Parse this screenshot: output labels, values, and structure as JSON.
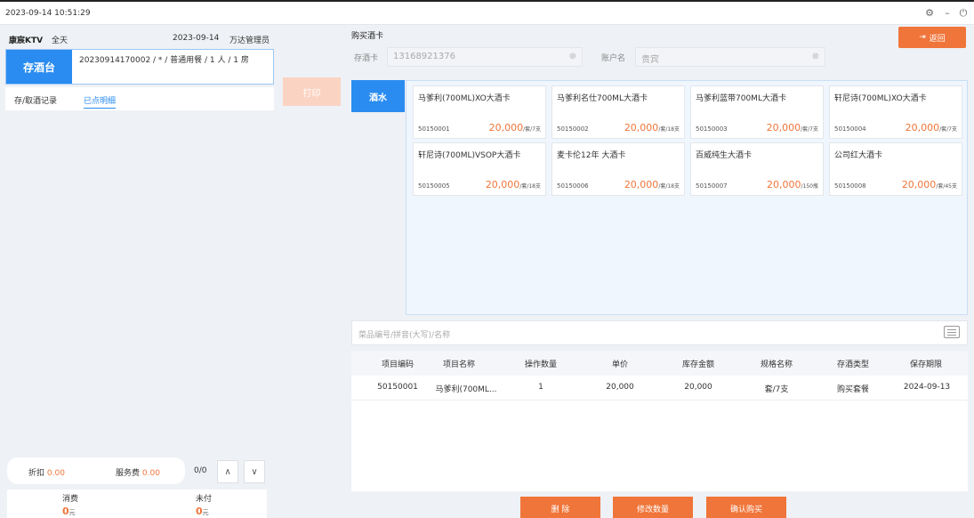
{
  "titlebar": {
    "time": "2023-09-14 10:51:29"
  },
  "left": {
    "store_name": "康宸KTV",
    "scope": "全天",
    "date": "2023-09-14",
    "manager": "万达管理员",
    "depot_label": "存酒台",
    "order_info": "20230914170002 / * / 普通用餐 / 1 人 / 1 房",
    "tabs": [
      "存/取酒记录",
      "已点明细"
    ],
    "discount_label": "折扣",
    "discount_value": "0.00",
    "service_label": "服务费",
    "service_value": "0.00",
    "ratio": "0/0",
    "consume_label": "消费",
    "consume_value": "0",
    "unpaid_label": "未付",
    "unpaid_value": "0",
    "currency_unit": "元"
  },
  "print_label": "打印",
  "right": {
    "title": "购买酒卡",
    "return_label": "返回",
    "card_no_label": "存酒卡",
    "card_no_value": "13168921376",
    "account_label": "账户名",
    "account_value": "贵宾",
    "category_label": "酒水",
    "products": [
      {
        "name": "马爹利(700ML)XO大酒卡",
        "code": "50150001",
        "price": "20,000",
        "unit": "/套/7支"
      },
      {
        "name": "马爹利名仕700ML大酒卡",
        "code": "50150002",
        "price": "20,000",
        "unit": "/套/18支"
      },
      {
        "name": "马爹利蓝带700ML大酒卡",
        "code": "50150003",
        "price": "20,000",
        "unit": "/套/7支"
      },
      {
        "name": "轩尼诗(700ML)XO大酒卡",
        "code": "50150004",
        "price": "20,000",
        "unit": "/套/7支"
      },
      {
        "name": "轩尼诗(700ML)VSOP大酒卡",
        "code": "50150005",
        "price": "20,000",
        "unit": "/套/18支"
      },
      {
        "name": "麦卡伦12年 大酒卡",
        "code": "50150006",
        "price": "20,000",
        "unit": "/套/18支"
      },
      {
        "name": "百威纯生大酒卡",
        "code": "50150007",
        "price": "20,000",
        "unit": "/150瓶"
      },
      {
        "name": "公司红大酒卡",
        "code": "50150008",
        "price": "20,000",
        "unit": "/套/45支"
      }
    ],
    "search_placeholder": "菜品编号/拼音(大写)/名称",
    "table": {
      "headers": [
        "项目编码",
        "项目名称",
        "操作数量",
        "单价",
        "库存金额",
        "规格名称",
        "存酒类型",
        "保存期限"
      ],
      "rows": [
        [
          "50150001",
          "马爹利(700ML...",
          "1",
          "20,000",
          "20,000",
          "套/7支",
          "购买套餐",
          "2024-09-13"
        ]
      ]
    },
    "buttons": [
      "删 除",
      "修改数量",
      "确认购买"
    ]
  }
}
